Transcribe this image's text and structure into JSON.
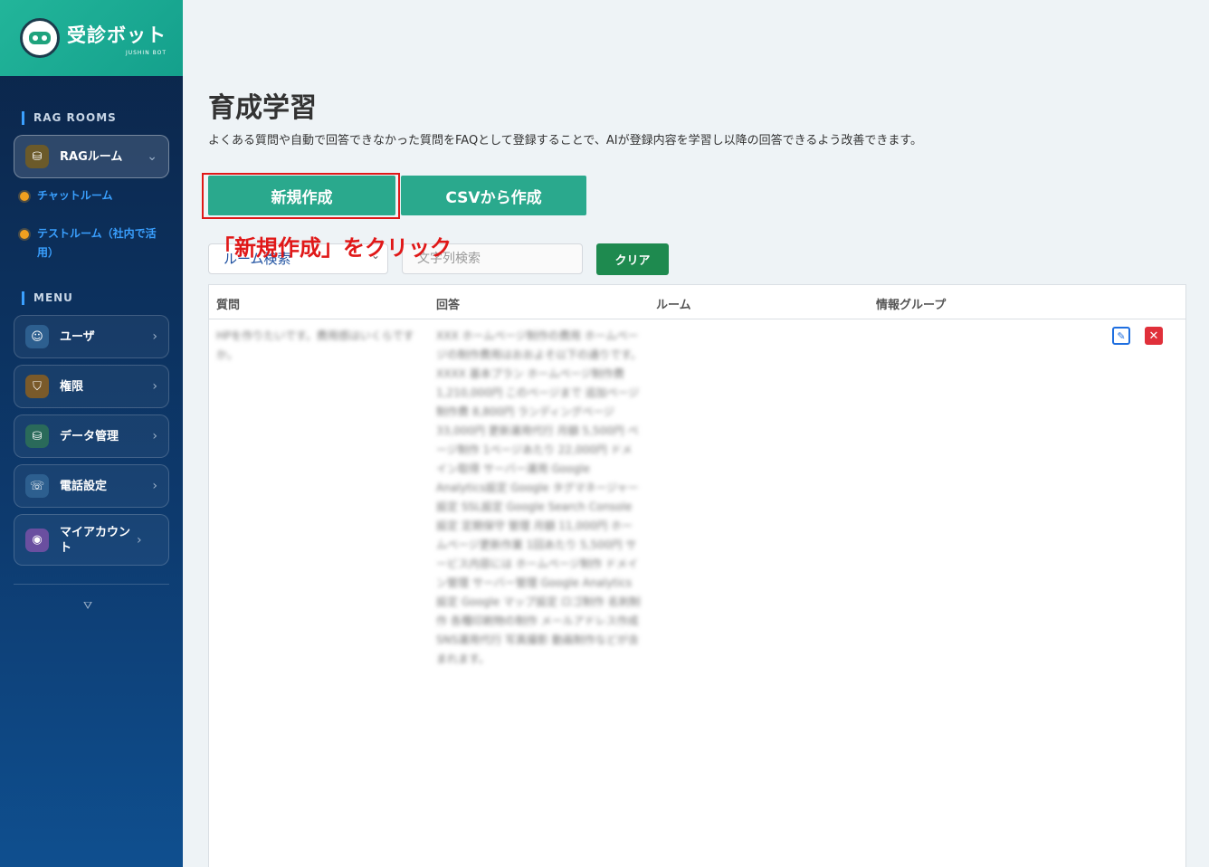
{
  "brand": {
    "title": "受診ボット",
    "subtitle": "JUSHIN BOT"
  },
  "sidebar": {
    "rag_section": "RAG ROOMS",
    "rag_room": {
      "label": "RAGルーム",
      "icon": "database-icon"
    },
    "rag_subitems": [
      "チャットルーム",
      "テストルーム（社内で活用）"
    ],
    "menu_section": "MENU",
    "menu_items": [
      {
        "label": "ユーザ",
        "icon": "user-icon",
        "color": "#2d5f8f"
      },
      {
        "label": "権限",
        "icon": "shield-icon",
        "color": "#8a6a2a"
      },
      {
        "label": "データ管理",
        "icon": "database-icon",
        "color": "#2a7a5a"
      },
      {
        "label": "電話設定",
        "icon": "phone-icon",
        "color": "#2d5f8f"
      },
      {
        "label": "マイアカウント",
        "icon": "account-icon",
        "color": "#6a4fa0"
      }
    ]
  },
  "main": {
    "title": "育成学習",
    "description": "よくある質問や自動で回答できなかった質問をFAQとして登録することで、AIが登録内容を学習し以降の回答できるよう改善できます。",
    "btn_new": "新規作成",
    "btn_csv": "CSVから作成",
    "callout": "「新規作成」をクリック",
    "room_select": "ルーム検索",
    "search_placeholder": "文字列検索",
    "btn_clear": "クリア",
    "table": {
      "columns": [
        "質問",
        "回答",
        "ルーム",
        "情報グループ"
      ],
      "row_question": "HPを作りたいです。費用感はいくらですか。",
      "row_answer": "XXX ホームページ制作の費用 ホームページの制作費用はおおよそ以下の通りです。XXXX 基本プラン ホームページ制作費 1,210,000円 このページまで 追加ページ制作費 8,800円 ランディングページ 33,000円 更新運用代行 月額 5,500円 ページ制作 1ページあたり 22,000円 ドメイン取得 サーバー運用 Google Analytics設定 Google タグマネージャー設定 SSL設定 Google Search Console設定 定期保守 管理 月額 11,000円 ホームページ更新作業 1回あたり 5,500円 サービス内容には ホームページ制作 ドメイン管理 サーバー管理 Google Analytics設定 Google マップ設定 ロゴ制作 名刺制作 各種印刷物の制作 メールアドレス作成 SNS運用代行 写真撮影 動画制作などが含まれます。"
    }
  }
}
